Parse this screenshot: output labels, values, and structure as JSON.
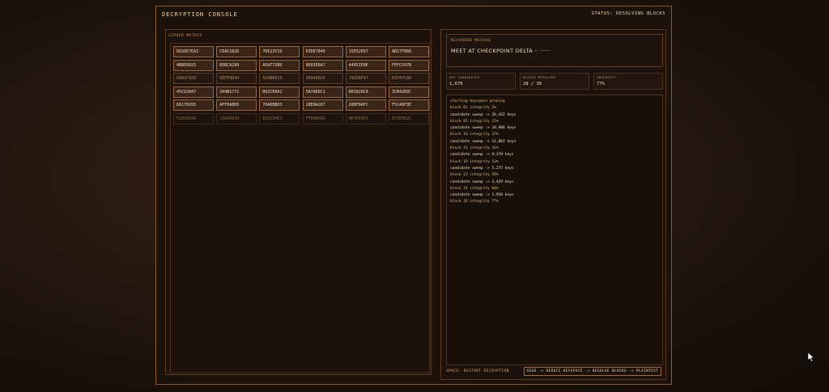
{
  "header": {
    "title": "DECRYPTION CONSOLE",
    "status": "STATUS: RESOLVING BLOCKS"
  },
  "matrix": {
    "label": "CIPHER MATRIX",
    "rows": [
      {
        "state": "active",
        "cells": [
          "D026E7EA3",
          "CEAC182D",
          "7DE2351D",
          "D3DE7040",
          "15E52ED7",
          "AB17F866"
        ]
      },
      {
        "state": "active",
        "cells": [
          "4B8E6025",
          "85BCA299",
          "A5A772BD",
          "9E03E6A7",
          "44051E0E",
          "FEFC597B"
        ]
      },
      {
        "state": "dim",
        "cells": [
          "6A02C920",
          "60FE0D44",
          "5DABB629",
          "3D946D2A",
          "7A20AF47",
          "B1FA7C80"
        ]
      },
      {
        "state": "active",
        "cells": [
          "45CD2847",
          "204B1771",
          "D62CE0A2",
          "5A7AEDC1",
          "B01820CA",
          "3CB42D9C"
        ]
      },
      {
        "state": "active",
        "cells": [
          "D6170285",
          "AFF0A8E6",
          "70A6BBD3",
          "28EDA267",
          "28DF8AFC",
          "F5149F3E"
        ]
      },
      {
        "state": "faint",
        "cells": [
          "52810436",
          "15A99834",
          "823C94E3",
          "FF69EADD",
          "8E7E4855",
          "D75D9E2C"
        ]
      }
    ]
  },
  "message": {
    "label": "RECOVERED MESSAGE",
    "text": "MEET AT CHECKPOINT DELTA ·· ·····"
  },
  "stats": [
    {
      "label": "KEY CANDIDATES",
      "value": "1,670"
    },
    {
      "label": "BLOCKS RESOLVED",
      "value": "28 / 36"
    },
    {
      "label": "INTEGRITY",
      "value": "77%"
    }
  ],
  "log": [
    {
      "text": "starting keyspace pruning",
      "emphasis": false
    },
    {
      "text": "block 02 integrity 5%",
      "emphasis": false
    },
    {
      "text": "candidate sweep -> 26,432 keys",
      "emphasis": true
    },
    {
      "text": "block 05 integrity 23%",
      "emphasis": false
    },
    {
      "text": "candidate sweep -> 18,906 keys",
      "emphasis": true
    },
    {
      "text": "block 10 integrity 37%",
      "emphasis": false
    },
    {
      "text": "candidate sweep -> 11,803 keys",
      "emphasis": true
    },
    {
      "text": "block 15 integrity 41%",
      "emphasis": false
    },
    {
      "text": "candidate sweep -> 8,379 keys",
      "emphasis": true
    },
    {
      "text": "block 19 integrity 53%",
      "emphasis": false
    },
    {
      "text": "candidate sweep -> 5,275 keys",
      "emphasis": true
    },
    {
      "text": "block 23 integrity 58%",
      "emphasis": false
    },
    {
      "text": "candidate sweep -> 3,429 keys",
      "emphasis": true
    },
    {
      "text": "block 24 integrity 66%",
      "emphasis": false
    },
    {
      "text": "candidate sweep -> 1,958 keys",
      "emphasis": true
    },
    {
      "text": "block 28 integrity 77%",
      "emphasis": false
    }
  ],
  "footer": {
    "hint": "SPACE: RESTART DECRYPTION",
    "flow": "SEED -> REDUCE KEYSPACE -> RESOLVE BLOCKS -> PLAINTEXT"
  },
  "icons": {
    "cursor": "mouse-cursor-icon"
  },
  "colors": {
    "accent": "#8a5a34",
    "text": "#e8cfa8",
    "panel": "#1c110b"
  }
}
